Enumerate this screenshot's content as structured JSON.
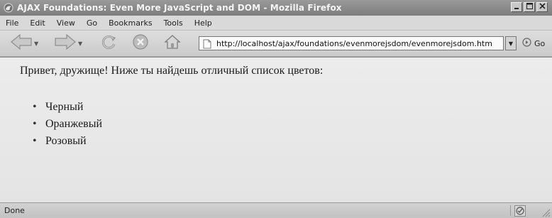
{
  "window": {
    "title": "AJAX Foundations: Even More JavaScript and DOM - Mozilla Firefox",
    "controls": {
      "minimize": "_",
      "maximize": "□",
      "close": "×"
    }
  },
  "menubar": {
    "items": [
      {
        "label": "File"
      },
      {
        "label": "Edit"
      },
      {
        "label": "View"
      },
      {
        "label": "Go"
      },
      {
        "label": "Bookmarks"
      },
      {
        "label": "Tools"
      },
      {
        "label": "Help"
      }
    ]
  },
  "toolbar": {
    "icons": [
      "back-icon",
      "forward-icon",
      "reload-icon",
      "stop-icon",
      "home-icon"
    ],
    "url": "http://localhost/ajax/foundations/evenmorejsdom/evenmorejsdom.html",
    "go_label": "Go"
  },
  "content": {
    "greeting": "Привет, дружище! Ниже ты найдешь отличный список цветов:",
    "colors": [
      "Черный",
      "Оранжевый",
      "Розовый"
    ]
  },
  "status": {
    "text": "Done"
  },
  "colors": {
    "titlebar": "#8a8a8a",
    "content_bg": "#ececec",
    "text": "#1a1a1a"
  }
}
